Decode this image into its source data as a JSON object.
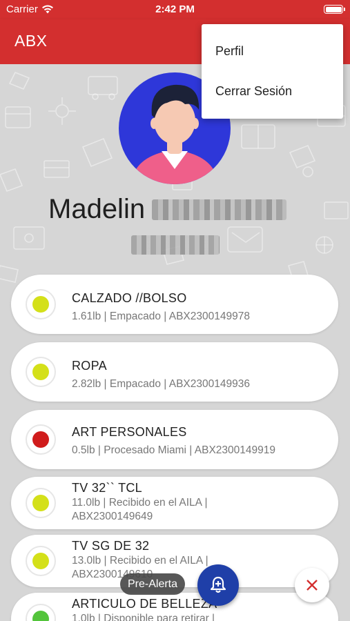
{
  "status_bar": {
    "carrier": "Carrier",
    "time": "2:42 PM"
  },
  "app_bar": {
    "title": "ABX"
  },
  "menu": {
    "items": [
      "Perfil",
      "Cerrar Sesión"
    ]
  },
  "profile": {
    "first_name": "Madelin"
  },
  "packages": [
    {
      "title": "CALZADO //BOLSO",
      "detail": "1.61lb | Empacado | ABX2300149978",
      "status_color": "#d4e019"
    },
    {
      "title": "ROPA",
      "detail": "2.82lb | Empacado | ABX2300149936",
      "status_color": "#d4e019"
    },
    {
      "title": "ART PERSONALES",
      "detail": "0.5lb | Procesado Miami | ABX2300149919",
      "status_color": "#d01c1c"
    },
    {
      "title": "TV 32`` TCL",
      "detail": "11.0lb | Recibido en el AILA | ABX2300149649",
      "status_color": "#d4e019"
    },
    {
      "title": "TV SG DE 32",
      "detail": "13.0lb | Recibido en el AILA | ABX2300149610",
      "status_color": "#d4e019"
    },
    {
      "title": "ARTICULO DE BELLEZA",
      "detail": "1.0lb | Disponible para retirar |",
      "status_color": "#53c43b"
    }
  ],
  "fab": {
    "label": "Pre-Alerta"
  },
  "colors": {
    "brand": "#d32f2f",
    "fab": "#1f3fa8",
    "avatar_bg": "#2e37d9"
  }
}
